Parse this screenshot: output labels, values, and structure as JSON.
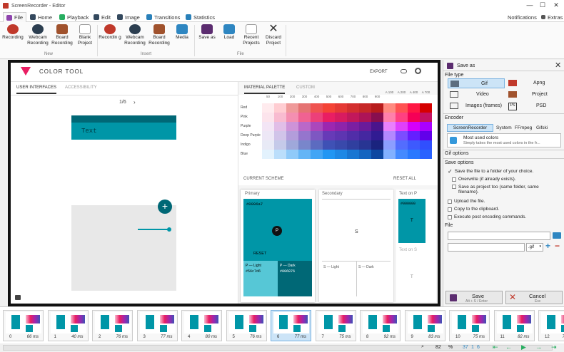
{
  "window": {
    "title": "ScreenRecorder - Editor",
    "min": "—",
    "max": "☐",
    "close": "✕"
  },
  "tabs": [
    {
      "label": "File",
      "color": "#8e44ad"
    },
    {
      "label": "Home",
      "color": "#2c3e50"
    },
    {
      "label": "Playback",
      "color": "#27ae60"
    },
    {
      "label": "Edit",
      "color": "#2c3e50"
    },
    {
      "label": "Image",
      "color": "#2c3e50"
    },
    {
      "label": "Transitions",
      "color": "#2980b9"
    },
    {
      "label": "Statistics",
      "color": "#2980b9"
    }
  ],
  "top_right": {
    "notifications": "Notifications",
    "extras": "Extras"
  },
  "ribbon": {
    "new": {
      "group": "New",
      "items": [
        "Recording",
        "Webcam Recording",
        "Board Recording",
        "Blank Project"
      ]
    },
    "insert": {
      "group": "Insert",
      "items": [
        "Recordin g",
        "Webcam Recording",
        "Board Recording",
        "Media"
      ]
    },
    "file": {
      "group": "File",
      "items": [
        "Save as",
        "Load",
        "Recent Projects",
        "Discard Project"
      ]
    }
  },
  "app": {
    "title": "COLOR  TOOL",
    "export": "EXPORT",
    "tabs": [
      "USER INTERFACES",
      "ACCESSIBILITY"
    ],
    "pager": "1/6",
    "pager_next": "›",
    "phone_text": "Text",
    "fab": "+",
    "palette_tabs": [
      "MATERIAL PALETTE",
      "CUSTOM"
    ],
    "shade_headers": [
      "50",
      "100",
      "200",
      "300",
      "400",
      "500",
      "600",
      "700",
      "800",
      "900",
      "A 100",
      "A 200",
      "A 400",
      "A 700"
    ],
    "palette_rows": [
      {
        "name": "Red",
        "colors": [
          "#ffebee",
          "#ffcdd2",
          "#ef9a9a",
          "#e57373",
          "#ef5350",
          "#f44336",
          "#e53935",
          "#d32f2f",
          "#c62828",
          "#b71c1c",
          "#ff8a80",
          "#ff5252",
          "#ff1744",
          "#d50000"
        ]
      },
      {
        "name": "Pink",
        "colors": [
          "#fce4ec",
          "#f8bbd0",
          "#f48fb1",
          "#f06292",
          "#ec407a",
          "#e91e63",
          "#d81b60",
          "#c2185b",
          "#ad1457",
          "#880e4f",
          "#ff80ab",
          "#ff4081",
          "#f50057",
          "#c51162"
        ]
      },
      {
        "name": "Purple",
        "colors": [
          "#f3e5f5",
          "#e1bee7",
          "#ce93d8",
          "#ba68c8",
          "#ab47bc",
          "#9c27b0",
          "#8e24aa",
          "#7b1fa2",
          "#6a1b9a",
          "#4a148c",
          "#ea80fc",
          "#e040fb",
          "#d500f9",
          "#aa00ff"
        ]
      },
      {
        "name": "Deep Purple",
        "colors": [
          "#ede7f6",
          "#d1c4e9",
          "#b39ddb",
          "#9575cd",
          "#7e57c2",
          "#673ab7",
          "#5e35b1",
          "#512da8",
          "#4527a0",
          "#311b92",
          "#b388ff",
          "#7c4dff",
          "#651fff",
          "#6200ea"
        ]
      },
      {
        "name": "Indigo",
        "colors": [
          "#e8eaf6",
          "#c5cae9",
          "#9fa8da",
          "#7986cb",
          "#5c6bc0",
          "#3f51b5",
          "#3949ab",
          "#303f9f",
          "#283593",
          "#1a237e",
          "#8c9eff",
          "#536dfe",
          "#3d5afe",
          "#304ffe"
        ]
      },
      {
        "name": "Blue",
        "colors": [
          "#e3f2fd",
          "#bbdefb",
          "#90caf9",
          "#64b5f6",
          "#42a5f5",
          "#2196f3",
          "#1e88e5",
          "#1976d2",
          "#1565c0",
          "#0d47a1",
          "#82b1ff",
          "#448aff",
          "#2979ff",
          "#2962ff"
        ]
      }
    ],
    "scheme_title": "CURRENT SCHEME",
    "reset_all": "RESET ALL",
    "primary": {
      "label": "Primary",
      "hex": "#0096a7",
      "p": "P",
      "reset": "RESET",
      "light_label": "P — Light",
      "light_hex": "#56c7d6",
      "dark_label": "P — Dark",
      "dark_hex": "#006876"
    },
    "secondary": {
      "label": "Secondary",
      "s": "S",
      "light": "S — Light",
      "dark": "S — Dark"
    },
    "text_on": {
      "label": "Text on P",
      "hex": "#000000",
      "t": "T",
      "label2": "Text on S",
      "t2": "T"
    }
  },
  "panel": {
    "title": "Save as",
    "file_type": "File type",
    "types": [
      "Gif",
      "Apng",
      "Video",
      "Project",
      "Images (frames)",
      "PSD"
    ],
    "encoder": "Encoder",
    "encoders": [
      "ScreenRecorder",
      "System",
      "FFmpeg",
      "Gifski"
    ],
    "preset_title": "Most used colors",
    "preset_desc": "Simply takes the most used colors in the fr...",
    "gif_options": "Gif options",
    "save_options": "Save options",
    "options": [
      {
        "label": "Save the file to a folder of your choice.",
        "checked": true
      },
      {
        "label": "Overwrite (if already exists).",
        "checked": false
      },
      {
        "label": "Save as project too (same folder, same filename).",
        "checked": false
      },
      {
        "label": "Upload the file.",
        "checked": false
      },
      {
        "label": "Copy to the clipboard.",
        "checked": false
      },
      {
        "label": "Execute post encoding commands.",
        "checked": false
      }
    ],
    "file_label": "File",
    "ext": ".gif",
    "save": "Save",
    "save_hint": "Alt + S / Enter",
    "cancel": "Cancel",
    "cancel_hint": "Esc"
  },
  "frames": [
    {
      "n": "0",
      "d": "66 ms"
    },
    {
      "n": "1",
      "d": "40 ms"
    },
    {
      "n": "2",
      "d": "76 ms"
    },
    {
      "n": "3",
      "d": "77 ms"
    },
    {
      "n": "4",
      "d": "80 ms"
    },
    {
      "n": "5",
      "d": "76 ms"
    },
    {
      "n": "6",
      "d": "77 ms"
    },
    {
      "n": "7",
      "d": "75 ms"
    },
    {
      "n": "8",
      "d": "92 ms"
    },
    {
      "n": "9",
      "d": "83 ms"
    },
    {
      "n": "10",
      "d": "75 ms"
    },
    {
      "n": "11",
      "d": "82 ms"
    },
    {
      "n": "12",
      "d": "76 ms"
    }
  ],
  "selected_frame": 6,
  "status": {
    "zoom": "82",
    "percent": "%",
    "count": "37",
    "selected": "1",
    "index": "6"
  }
}
